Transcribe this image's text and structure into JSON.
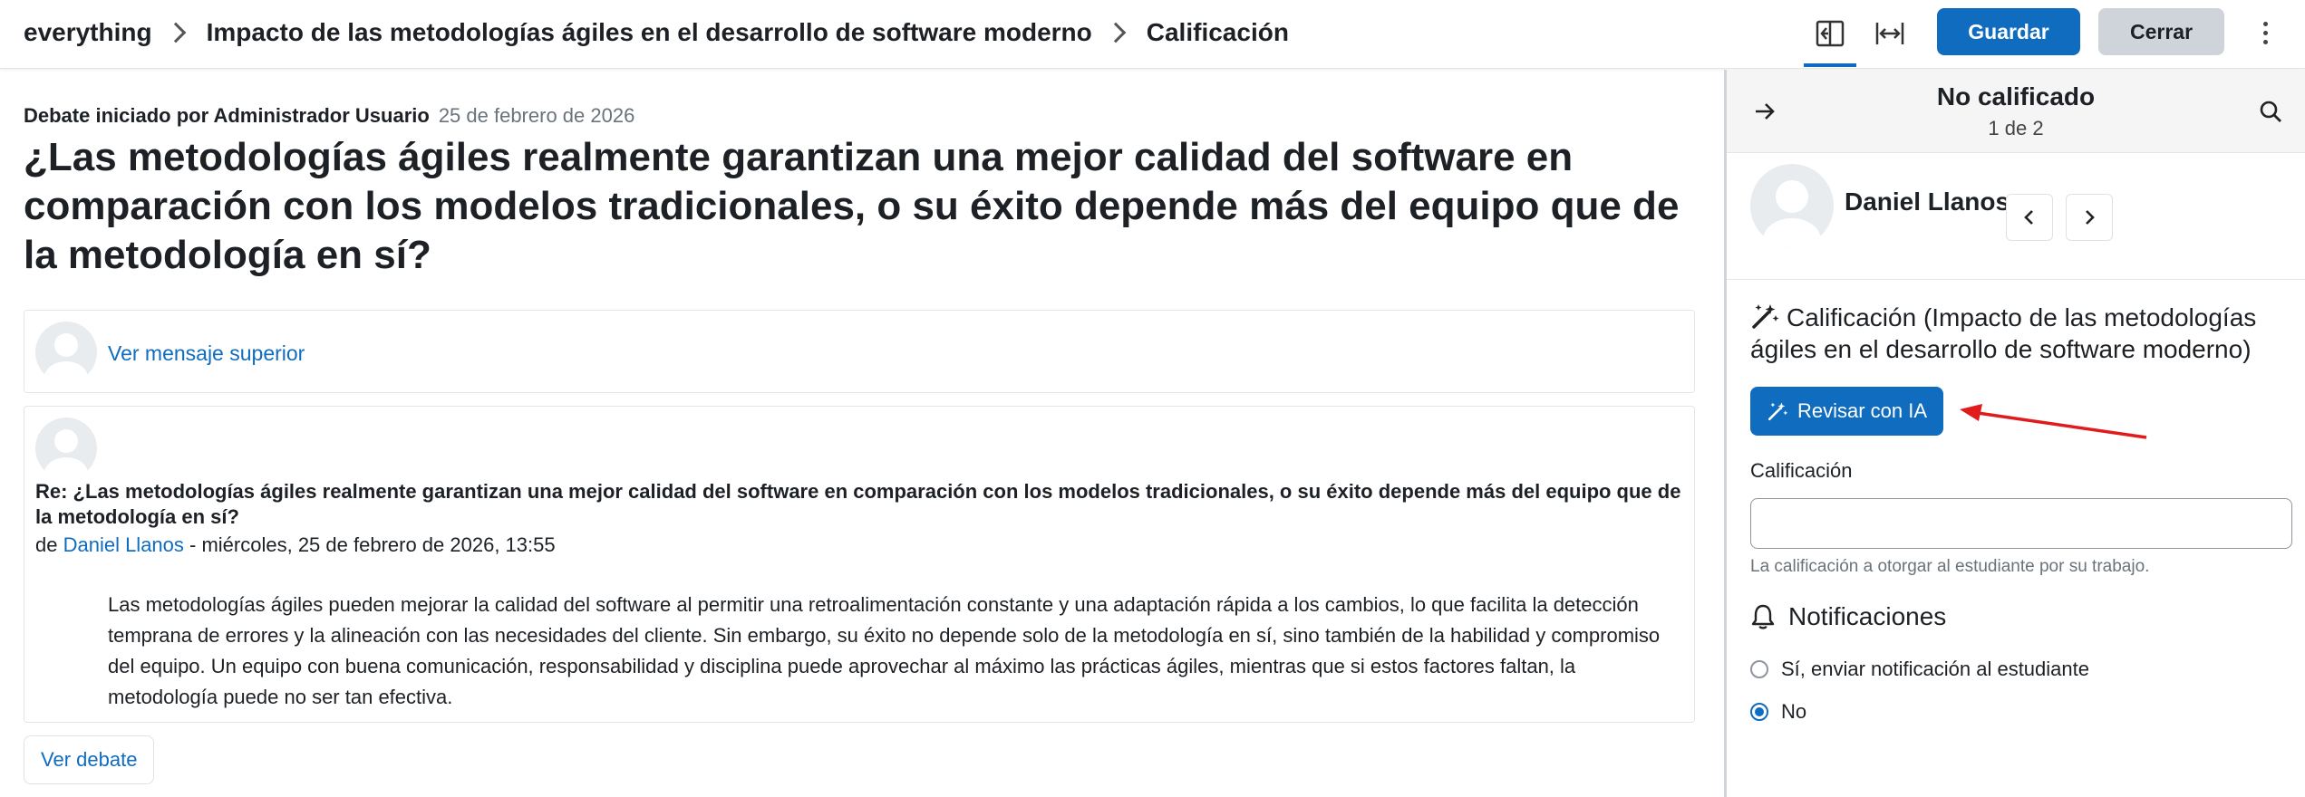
{
  "header": {
    "breadcrumbs": [
      "everything",
      "Impacto de las metodologías ágiles en el desarrollo de software moderno",
      "Calificación"
    ],
    "save_label": "Guardar",
    "close_label": "Cerrar"
  },
  "discussion": {
    "started_by": "Debate iniciado por Administrador Usuario",
    "started_date": "25 de febrero de 2026",
    "title": "¿Las metodologías ágiles realmente garantizan una mejor calidad del software en comparación con los modelos tradicionales, o su éxito depende más del equipo que de la metodología en sí?",
    "parent_link": "Ver mensaje superior",
    "post": {
      "subject": "Re: ¿Las metodologías ágiles realmente garantizan una mejor calidad del software en comparación con los modelos tradicionales, o su éxito depende más del equipo que de la metodología en sí?",
      "by_prefix": "de ",
      "author": "Daniel Llanos",
      "date": " - miércoles, 25 de febrero de 2026, 13:55",
      "body": "Las metodologías ágiles pueden mejorar la calidad del software al permitir una retroalimentación constante y una adaptación rápida a los cambios, lo que facilita la detección temprana de errores y la alineación con las necesidades del cliente. Sin embargo, su éxito no depende solo de la metodología en sí, sino también de la habilidad y compromiso del equipo. Un equipo con buena comunicación, responsabilidad y disciplina puede aprovechar al máximo las prácticas ágiles, mientras que si estos factores faltan, la metodología puede no ser tan efectiva."
    },
    "view_discussion": "Ver debate"
  },
  "panel": {
    "status": "No calificado",
    "count": "1 de 2",
    "user_name": "Daniel Llanos",
    "grade_heading": "Calificación (Impacto de las metodologías ágiles en el desarrollo de software moderno)",
    "ai_button": "Revisar con IA",
    "grade_label": "Calificación",
    "grade_value": "",
    "grade_help": "La calificación a otorgar al estudiante por su trabajo.",
    "notifications_heading": "Notificaciones",
    "options": [
      "Sí, enviar notificación al estudiante",
      "No"
    ],
    "selected_option": "No"
  },
  "colors": {
    "accent": "#0f6cbf",
    "annotation_arrow": "#e01b1b"
  }
}
